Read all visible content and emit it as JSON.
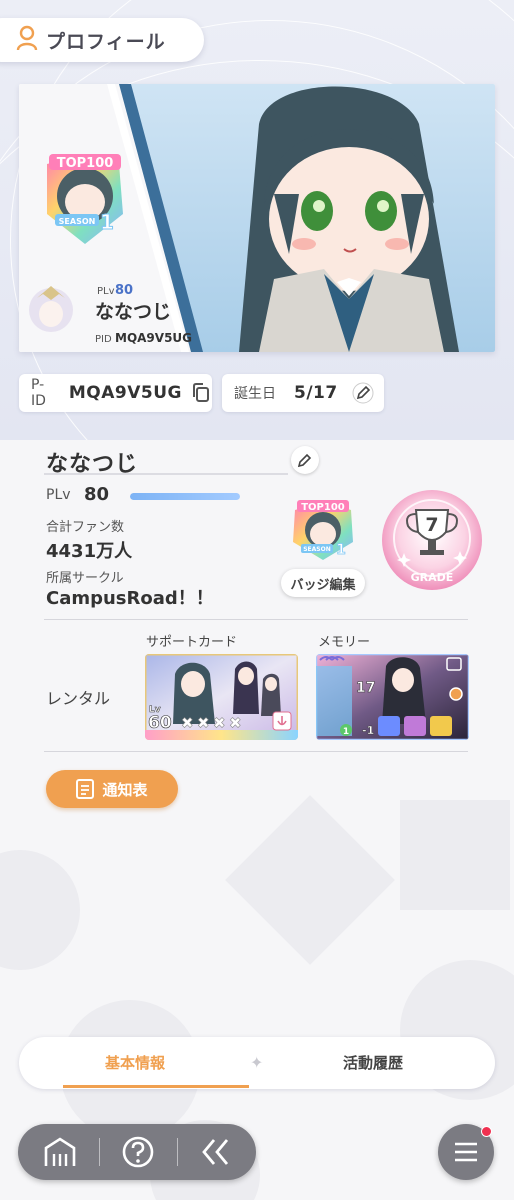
{
  "header": {
    "title": "プロフィール",
    "icon": "person-icon"
  },
  "banner": {
    "badge_text": "TOP100",
    "badge_season": "SEASON",
    "badge_number": "1",
    "plv_label": "PLv",
    "plv_value": "80",
    "name": "ななつじ",
    "pid_label": "PID",
    "pid_value": "MQA9V5UG"
  },
  "info": {
    "pid_label": "P-ID",
    "pid_value": "MQA9V5UG",
    "birthday_label": "誕生日",
    "birthday_value": "5/17",
    "copy_icon": "copy-icon",
    "edit_icon": "pencil-icon"
  },
  "profile": {
    "name": "ななつじ",
    "plv_label": "PLv",
    "plv_value": "80",
    "plv_progress": 1.0,
    "fans_label": "合計ファン数",
    "fans_value": "4431万人",
    "circle_label": "所属サークル",
    "circle_value": "CampusRoad！！",
    "badge_edit_label": "バッジ編集",
    "grade_label": "GRADE",
    "grade_value": "7"
  },
  "rental": {
    "label": "レンタル",
    "support_title": "サポートカード",
    "support_lv_label": "Lv",
    "support_lv": "60",
    "memory_title": "メモリー",
    "memory_value": "17",
    "memory_sub1": "1",
    "memory_sub2": "-1"
  },
  "notice": {
    "label": "通知表"
  },
  "tabs": [
    {
      "label": "基本情報",
      "active": true
    },
    {
      "label": "活動履歴",
      "active": false
    }
  ],
  "nav": {
    "home_icon": "home-icon",
    "help_icon": "help-icon",
    "back_icon": "back-chevrons-icon",
    "menu_icon": "menu-icon"
  },
  "colors": {
    "accent": "#f0a050",
    "nav_bg": "#7b7b82",
    "notification": "#f03050",
    "grade_pink": "#f4a6c8"
  }
}
